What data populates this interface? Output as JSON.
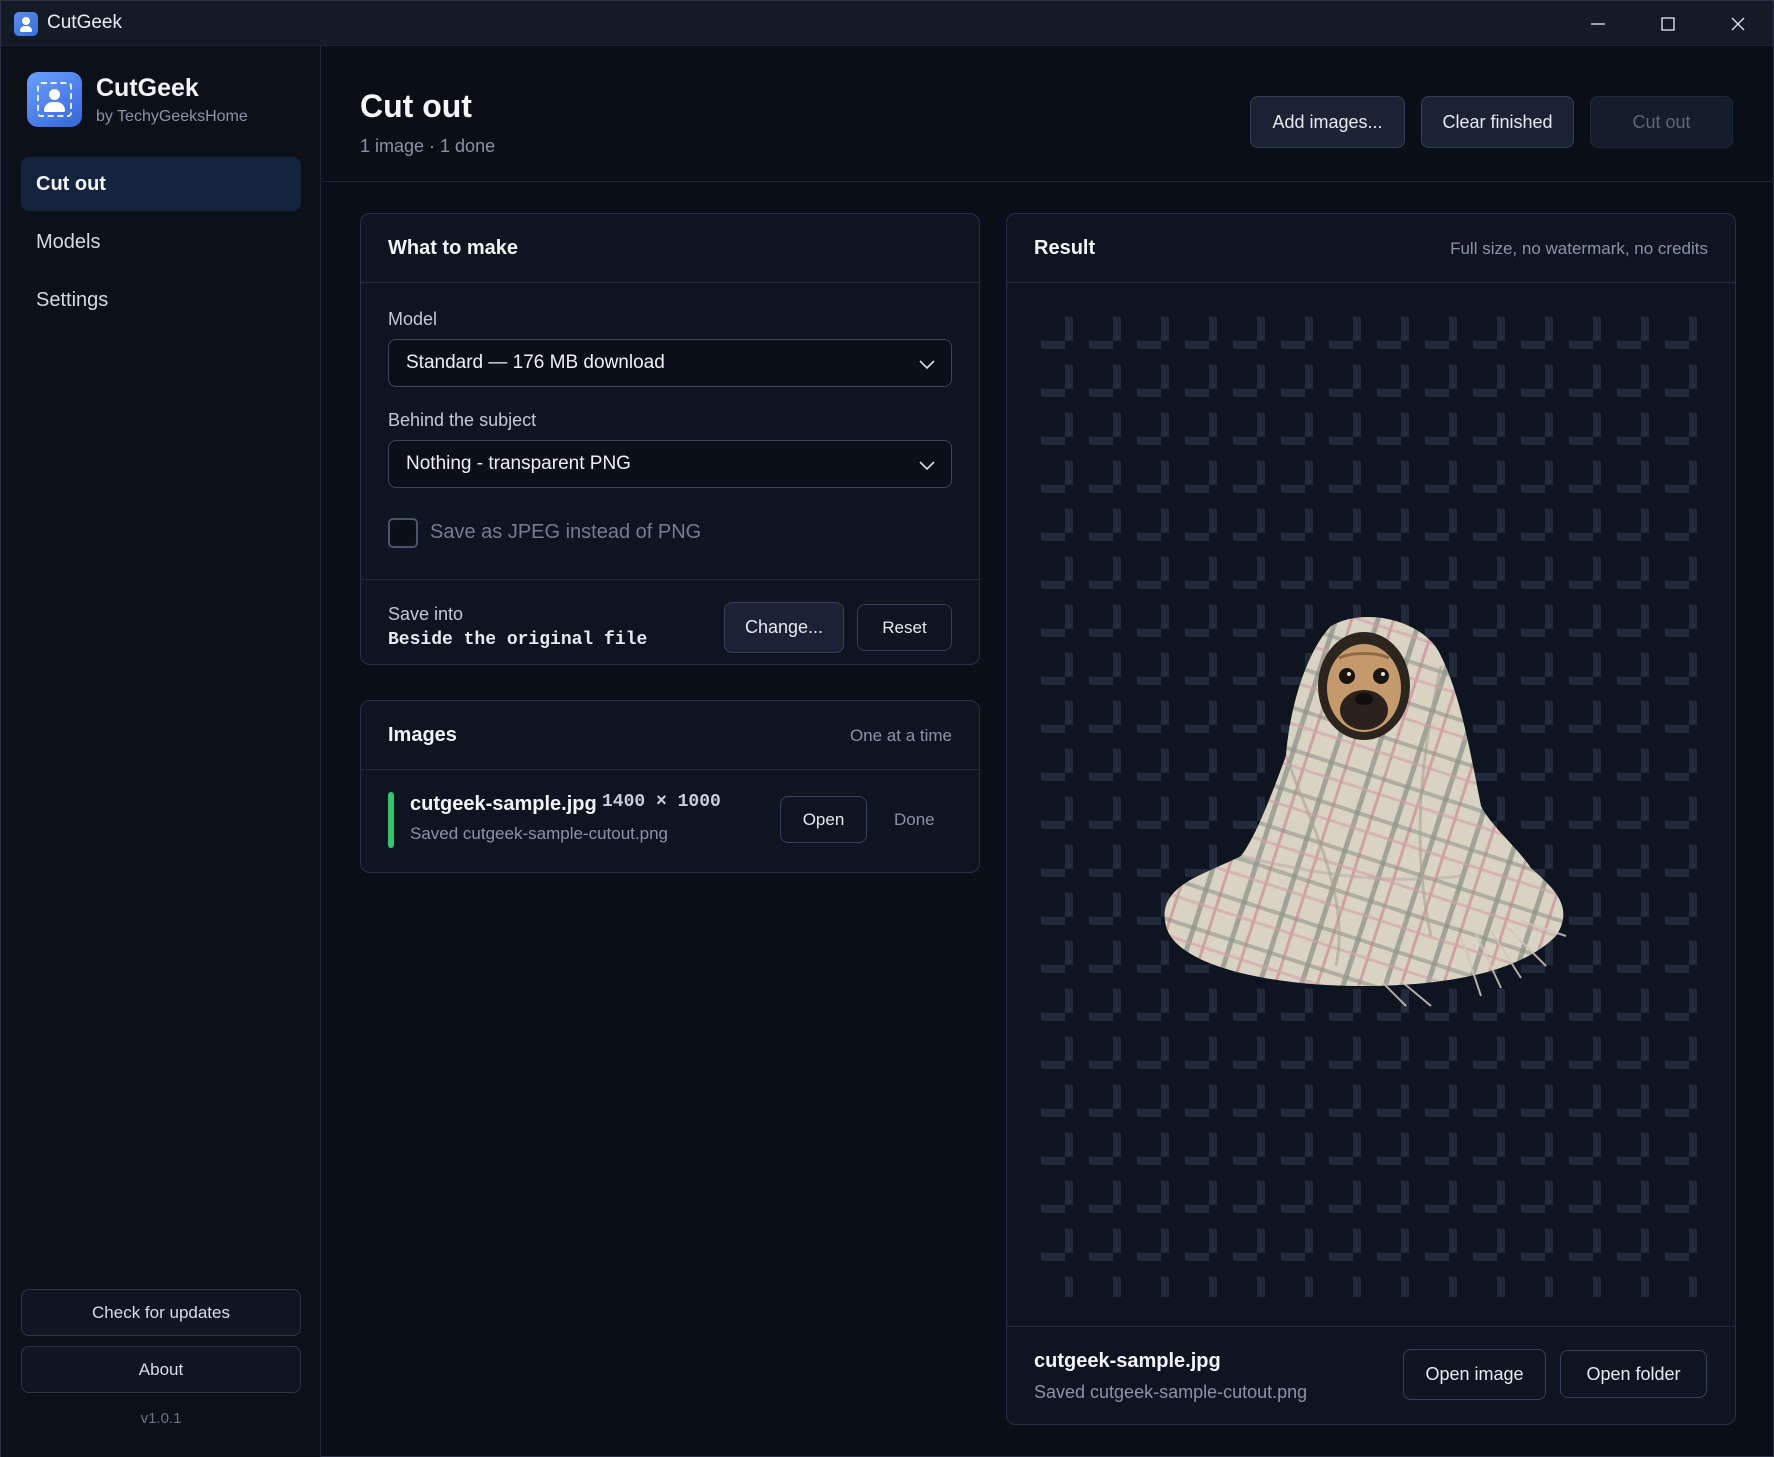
{
  "window": {
    "title": "CutGeek"
  },
  "sidebar": {
    "brand_name": "CutGeek",
    "brand_sub": "by TechyGeeksHome",
    "items": [
      {
        "label": "Cut out",
        "active": true
      },
      {
        "label": "Models",
        "active": false
      },
      {
        "label": "Settings",
        "active": false
      }
    ],
    "check_updates": "Check for updates",
    "about": "About",
    "version": "v1.0.1"
  },
  "header": {
    "title": "Cut out",
    "subtitle": "1 image · 1 done",
    "add_images": "Add images...",
    "clear_finished": "Clear finished",
    "cut_out": "Cut out"
  },
  "what_to_make": {
    "title": "What to make",
    "model_label": "Model",
    "model_value": "Standard — 176 MB download",
    "behind_label": "Behind the subject",
    "behind_value": "Nothing - transparent PNG",
    "jpeg_label": "Save as JPEG instead of PNG",
    "jpeg_checked": false,
    "save_into_label": "Save into",
    "save_into_value": "Beside the original file",
    "change": "Change...",
    "reset": "Reset"
  },
  "images": {
    "title": "Images",
    "note": "One at a time",
    "items": [
      {
        "name": "cutgeek-sample.jpg",
        "dims": "1400 × 1000",
        "status_text": "Saved cutgeek-sample-cutout.png",
        "open": "Open",
        "state": "Done"
      }
    ]
  },
  "result": {
    "title": "Result",
    "note": "Full size, no watermark, no credits",
    "file_name": "cutgeek-sample.jpg",
    "file_status": "Saved cutgeek-sample-cutout.png",
    "open_image": "Open image",
    "open_folder": "Open folder"
  },
  "colors": {
    "accent": "#3a6fd8",
    "done_green": "#36c46a",
    "background": "#0a0e17"
  }
}
